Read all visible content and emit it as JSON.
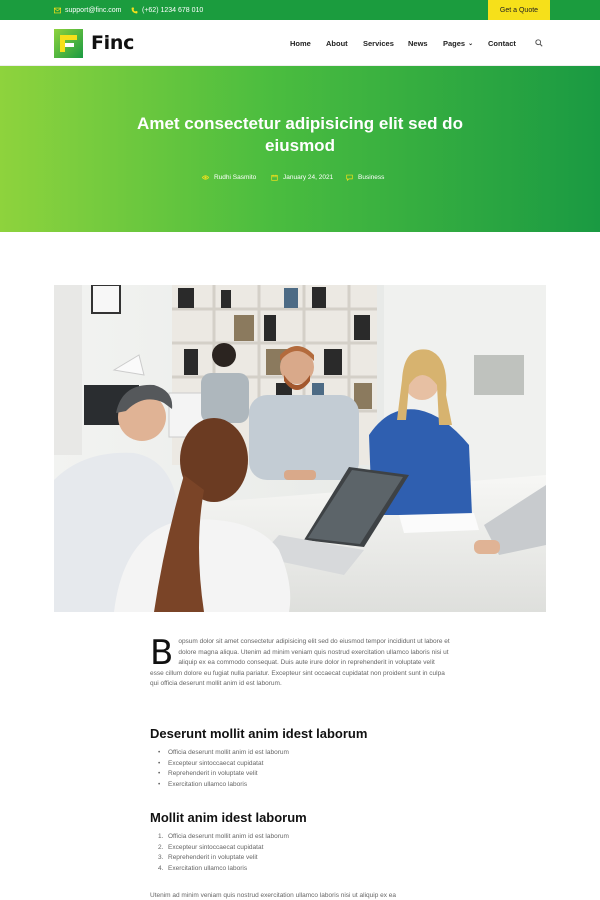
{
  "topbar": {
    "email": "support@finc.com",
    "phone": "(+62) 1234 678 010",
    "quote_label": "Get a Quote"
  },
  "brand": {
    "name": "Finc",
    "accent": "#1b9c3e",
    "logo_colors": [
      "#8ed33d",
      "#1a9a42",
      "#f6e01a"
    ]
  },
  "nav": {
    "home": "Home",
    "about": "About",
    "services": "Services",
    "news": "News",
    "pages": "Pages",
    "contact": "Contact",
    "search_icon": "search-icon"
  },
  "hero": {
    "title": "Amet consectetur adipisicing elit sed do eiusmod",
    "author": "Rudhi Sasmito",
    "date": "January 24, 2021",
    "category": "Business"
  },
  "article": {
    "dropcap": "B",
    "intro": "opsum dolor sit amet consectetur adipisicing elit sed do eiusmod tempor incididunt ut labore et dolore magna aliqua. Utenim ad minim veniam quis nostrud exercitation ullamco laboris nisi ut aliquip ex ea commodo consequat. Duis aute irure dolor in reprehenderit in voluptate velit esse cillum dolore eu fugiat nulla pariatur. Excepteur sint occaecat cupidatat non proident sunt in culpa qui officia deserunt mollit anim id est laborum.",
    "heading1": "Deserunt mollit anim idest laborum",
    "list1": [
      "Officia deserunt mollit anim id est laborum",
      "Excepteur sintoccaecat cupidatat",
      "Reprehenderit in voluptate velit",
      "Exercitation ullamco laboris"
    ],
    "heading2": "Mollit anim idest laborum",
    "list2": [
      "Officia deserunt mollit anim id est laborum",
      "Excepteur sintoccaecat cupidatat",
      "Reprehenderit in voluptate velit",
      "Exercitation ullamco laboris"
    ],
    "list2_numbers": [
      "1.",
      "2.",
      "3.",
      "4."
    ],
    "outro": "Utenim ad minim veniam quis nostrud exercitation ullamco laboris nisi ut aliquip ex ea"
  }
}
